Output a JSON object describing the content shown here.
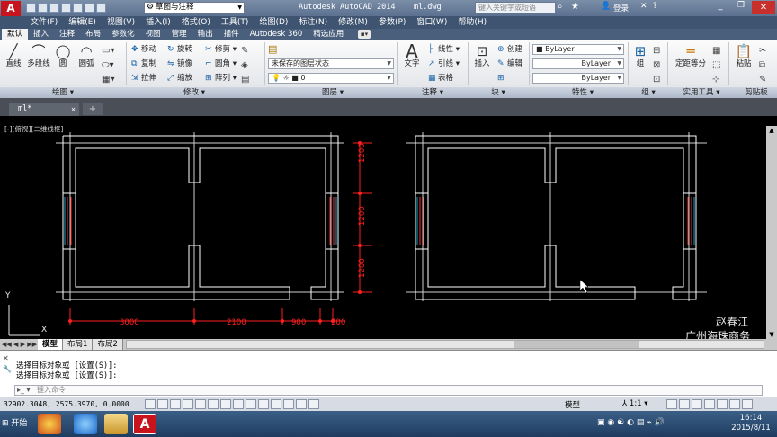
{
  "titlebar": {
    "workspace": "草图与注释",
    "app_title": "Autodesk AutoCAD 2014",
    "file_name": "ml.dwg",
    "search_placeholder": "键入关键字或短语",
    "login": "登录"
  },
  "menu": [
    "文件(F)",
    "编辑(E)",
    "视图(V)",
    "插入(I)",
    "格式(O)",
    "工具(T)",
    "绘图(D)",
    "标注(N)",
    "修改(M)",
    "参数(P)",
    "窗口(W)",
    "帮助(H)"
  ],
  "ribbon_tabs": [
    "默认",
    "插入",
    "注释",
    "布局",
    "参数化",
    "视图",
    "管理",
    "输出",
    "插件",
    "Autodesk 360",
    "精选应用"
  ],
  "ribbon": {
    "draw": {
      "line": "直线",
      "polyline": "多段线",
      "circle": "圆",
      "arc": "圆弧"
    },
    "modify": {
      "move": "移动",
      "rotate": "旋转",
      "trim": "修剪",
      "copy": "复制",
      "mirror": "镜像",
      "fillet": "圆角",
      "stretch": "拉伸",
      "scale": "缩放",
      "array": "阵列"
    },
    "layers": {
      "state": "未保存的图层状态",
      "current": "0"
    },
    "annotation": {
      "text": "文字",
      "linear": "线性",
      "leader": "引线",
      "table": "表格"
    },
    "block": {
      "insert": "插入",
      "create": "创建",
      "edit": "编辑"
    },
    "properties": {
      "color": "ByLayer",
      "linetype": "ByLayer",
      "lineweight": "ByLayer"
    },
    "groups": {
      "group": "组"
    },
    "utilities": {
      "measure": "定距等分"
    },
    "clipboard": {
      "paste": "粘贴"
    }
  },
  "panel_labels": {
    "draw": "绘图",
    "modify": "修改",
    "layers": "图层",
    "annotation": "注释",
    "block": "块",
    "properties": "特性",
    "groups": "组",
    "utilities": "实用工具",
    "clipboard": "剪贴板"
  },
  "doc_tab": "ml*",
  "viewport_label": "[-][俯视][二维线框]",
  "dimensions": {
    "bottom": [
      "3000",
      "2100",
      "900",
      "300"
    ],
    "right": [
      "1200",
      "1200",
      "1200"
    ]
  },
  "watermark": {
    "line1": "赵春江",
    "line2": "广州海珠商务"
  },
  "layout_tabs": [
    "模型",
    "布局1",
    "布局2"
  ],
  "command_history": [
    "选择目标对象或 [设置(S)]:",
    "选择目标对象或 [设置(S)]:"
  ],
  "command_placeholder": "键入命令",
  "status": {
    "coords": "32902.3048, 2575.3970, 0.0000",
    "model": "模型",
    "scale": "1:1"
  },
  "taskbar": {
    "start": "开始",
    "time": "16:14",
    "date": "2015/8/11"
  }
}
